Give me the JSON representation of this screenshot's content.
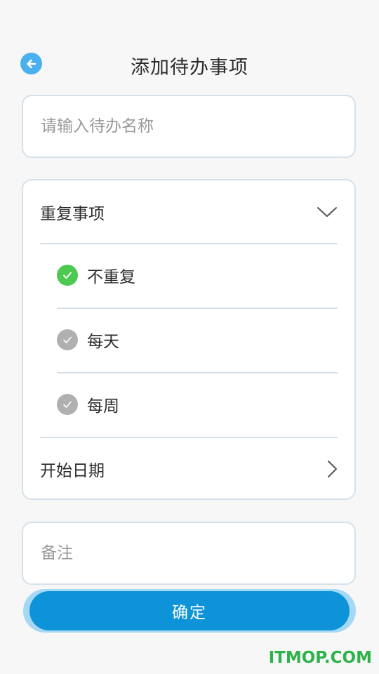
{
  "header": {
    "title": "添加待办事项"
  },
  "name_field": {
    "placeholder": "请输入待办名称",
    "value": ""
  },
  "repeat": {
    "label": "重复事项",
    "options": [
      {
        "label": "不重复",
        "selected": true
      },
      {
        "label": "每天",
        "selected": false
      },
      {
        "label": "每周",
        "selected": false
      }
    ],
    "start_date_label": "开始日期"
  },
  "note_field": {
    "placeholder": "备注",
    "value": ""
  },
  "confirm_label": "确定",
  "watermark": "ITMOP.COM",
  "colors": {
    "accent": "#0e93d8",
    "back_button": "#4ab0ee",
    "checked": "#4cc94e",
    "unchecked": "#b0b0b0",
    "watermark": "#2db24a"
  },
  "icons": {
    "back": "arrow-left-icon",
    "expand": "chevron-down-icon",
    "navigate": "chevron-right-icon",
    "check": "check-icon"
  }
}
